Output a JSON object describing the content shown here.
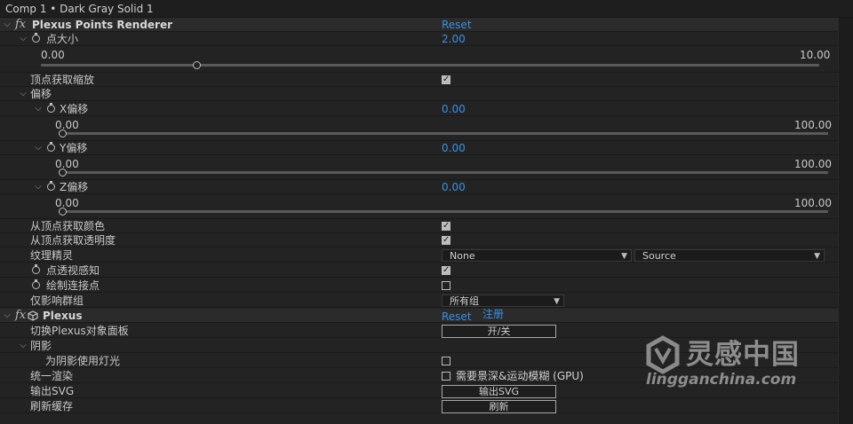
{
  "title": "Comp 1 • Dark Gray Solid 1",
  "effect1": {
    "name": "Plexus Points Renderer",
    "reset": "Reset",
    "point_size": {
      "label": "点大小",
      "value": "2.00",
      "min": "0.00",
      "max": "10.00",
      "slider_fraction": 0.2
    },
    "scale_from_vertex": {
      "label": "顶点获取缩放",
      "checked": true
    },
    "offset": {
      "label": "偏移",
      "x": {
        "label": "X偏移",
        "value": "0.00",
        "min": "0.00",
        "max": "100.00",
        "slider_fraction": 0.0
      },
      "y": {
        "label": "Y偏移",
        "value": "0.00",
        "min": "0.00",
        "max": "100.00",
        "slider_fraction": 0.0
      },
      "z": {
        "label": "Z偏移",
        "value": "0.00",
        "min": "0.00",
        "max": "100.00",
        "slider_fraction": 0.0
      }
    },
    "color_from_vertex": {
      "label": "从顶点获取颜色",
      "checked": true
    },
    "opacity_from_vertex": {
      "label": "从顶点获取透明度",
      "checked": true
    },
    "texture_sprite": {
      "label": "纹理精灵",
      "value1": "None",
      "value2": "Source"
    },
    "perspective": {
      "label": "点透视感知",
      "checked": true
    },
    "draw_connect": {
      "label": "绘制连接点",
      "checked": false
    },
    "group": {
      "label": "仅影响群组",
      "value": "所有组"
    }
  },
  "effect2": {
    "name": "Plexus",
    "reset": "Reset",
    "register": "注册",
    "toggle_panel": {
      "label": "切换Plexus对象面板",
      "button": "开/关"
    },
    "shadow": {
      "label": "阴影",
      "lights": {
        "label": "为阴影使用灯光",
        "checked": false
      }
    },
    "unified_render": {
      "label": "统一渲染",
      "checked": false,
      "note": "需要景深&运动模糊 (GPU)"
    },
    "export_svg": {
      "label": "输出SVG",
      "button": "输出SVG"
    },
    "refresh_cache": {
      "label": "刷新缓存",
      "button": "刷新"
    }
  },
  "watermark": {
    "brand": "灵感中国",
    "url": "lingganchina.com"
  },
  "colors": {
    "value_blue": "#3a8fe6",
    "bg": "#232323",
    "header": "#2b2b2b"
  }
}
